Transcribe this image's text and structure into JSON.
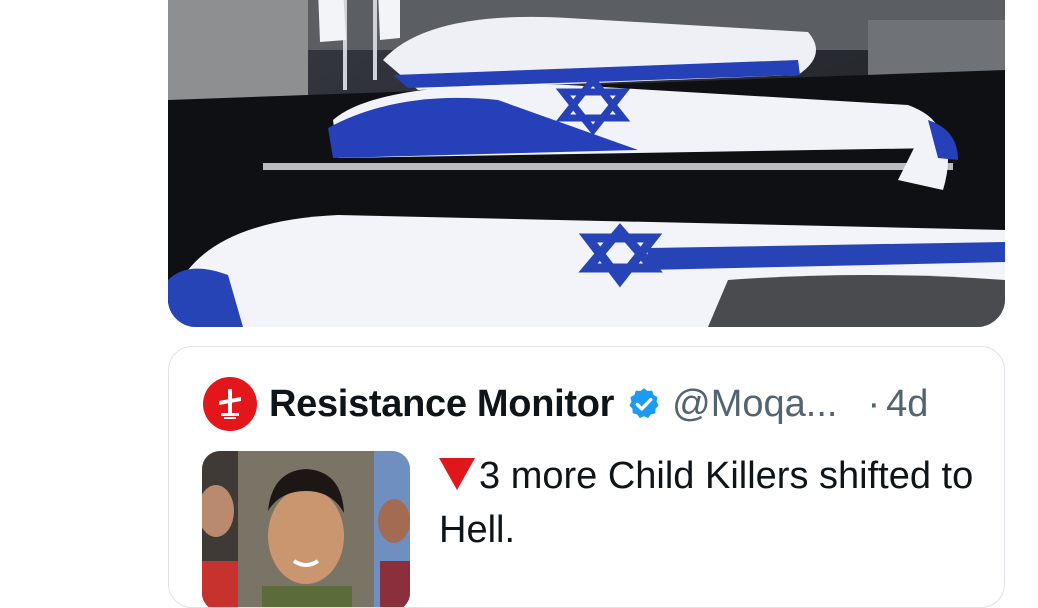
{
  "quoted_tweet": {
    "author_name": "Resistance Monitor",
    "handle": "@Moqa...",
    "separator": "·",
    "time": "4d",
    "text": "3 more Child Killers shifted to Hell.",
    "verified_color": "#1d9bf0",
    "avatar_color": "#e3161b"
  },
  "media": {
    "flag_blue": "#1f3fb0"
  }
}
